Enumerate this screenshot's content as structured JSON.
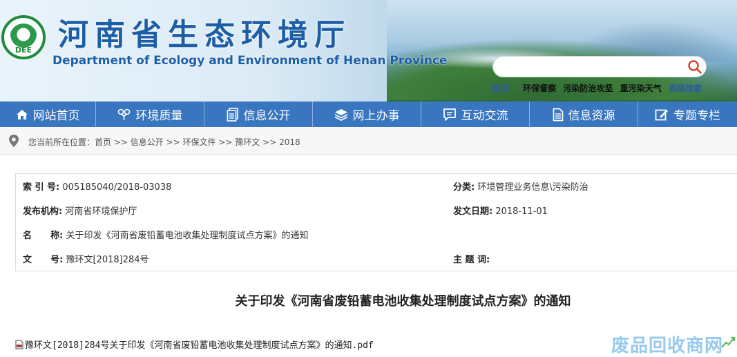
{
  "header": {
    "site_name_cn": "河南省生态环境厅",
    "site_name_en": "Department of Ecology and Environment of Henan Province",
    "logo_text": "DEE",
    "search_placeholder": "",
    "hot_label": "热词：",
    "hot_words": [
      "环保督察",
      "污染防治攻坚",
      "重污染天气"
    ],
    "advanced_search": "高级检索"
  },
  "nav": {
    "items": [
      {
        "label": "网站首页",
        "icon": "home-icon"
      },
      {
        "label": "环境质量",
        "icon": "leaf-icon"
      },
      {
        "label": "信息公开",
        "icon": "document-icon"
      },
      {
        "label": "网上办事",
        "icon": "layers-icon"
      },
      {
        "label": "互动交流",
        "icon": "chat-icon"
      },
      {
        "label": "信息资源",
        "icon": "file-icon"
      },
      {
        "label": "专题专栏",
        "icon": "edit-icon"
      }
    ]
  },
  "breadcrumb": {
    "prefix": "您当前所在位置：",
    "items": [
      "首页",
      "信息公开",
      "环保文件",
      "豫环文",
      "2018"
    ],
    "separator": " >> "
  },
  "meta": {
    "index_label": "索 引 号:",
    "index_value": "005185040/2018-03038",
    "category_label": "分类:",
    "category_value": "环境管理业务信息\\污染防治",
    "publisher_label": "发布机构:",
    "publisher_value": "河南省环境保护厅",
    "date_label": "发文日期:",
    "date_value": "2018-11-01",
    "name_label": "名      称:",
    "name_value": "关于印发《河南省废铅蓄电池收集处理制度试点方案》的通知",
    "docno_label": "文      号:",
    "docno_value": "豫环文[2018]284号",
    "keywords_label": "主 题 词:",
    "keywords_value": ""
  },
  "article": {
    "title": "关于印发《河南省废铅蓄电池收集处理制度试点方案》的通知",
    "attachment": "豫环文[2018]284号关于印发《河南省废铅蓄电池收集处理制度试点方案》的通知.pdf"
  },
  "watermark": {
    "text": "废品回收商网"
  },
  "colors": {
    "nav_bg": "#3976bf",
    "brand_blue": "#1d5fa6",
    "logo_green": "#1f8a3b"
  }
}
